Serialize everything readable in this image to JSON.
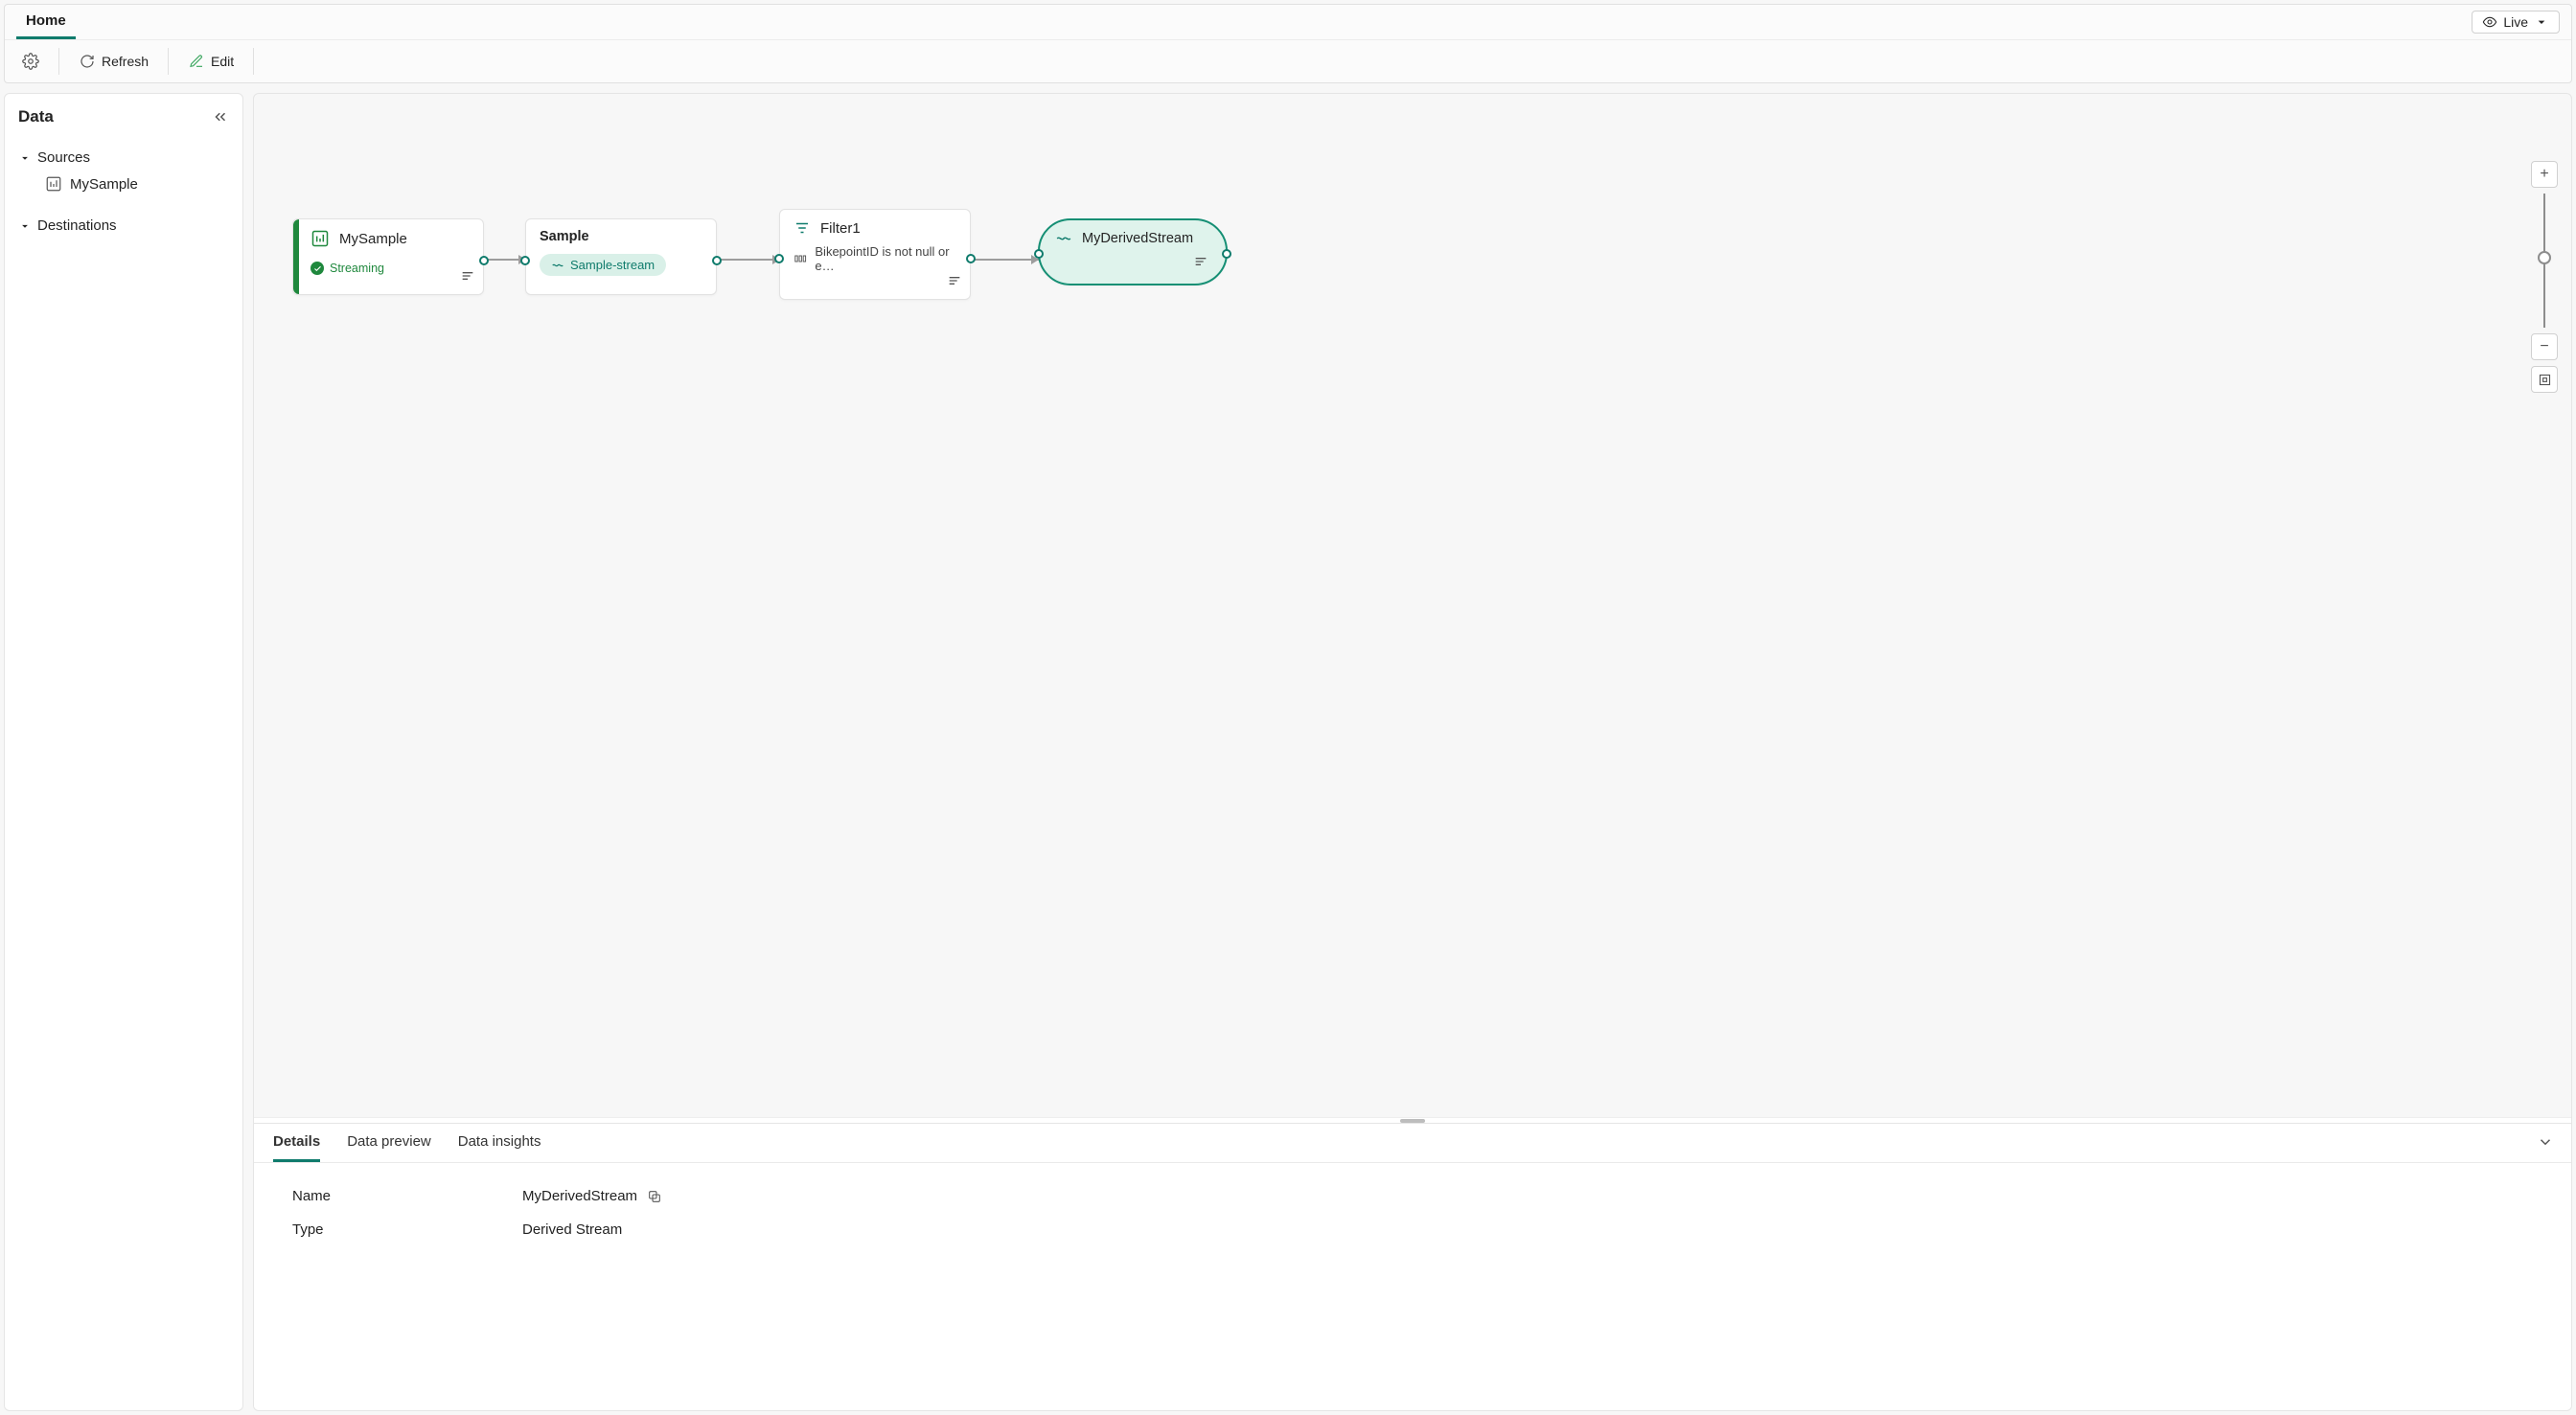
{
  "header": {
    "active_tab": "Home",
    "live_label": "Live",
    "ribbon": {
      "refresh": "Refresh",
      "edit": "Edit"
    }
  },
  "data_panel": {
    "title": "Data",
    "sources_label": "Sources",
    "destinations_label": "Destinations",
    "sources": [
      {
        "label": "MySample"
      }
    ]
  },
  "canvas": {
    "nodes": {
      "source": {
        "title": "MySample",
        "status": "Streaming"
      },
      "sample": {
        "title": "Sample",
        "chip": "Sample-stream"
      },
      "filter": {
        "title": "Filter1",
        "rule": "BikepointID is not null or e…"
      },
      "derived": {
        "title": "MyDerivedStream"
      }
    }
  },
  "bottom": {
    "tabs": [
      "Details",
      "Data preview",
      "Data insights"
    ],
    "details": {
      "name_label": "Name",
      "name_value": "MyDerivedStream",
      "type_label": "Type",
      "type_value": "Derived Stream"
    }
  }
}
